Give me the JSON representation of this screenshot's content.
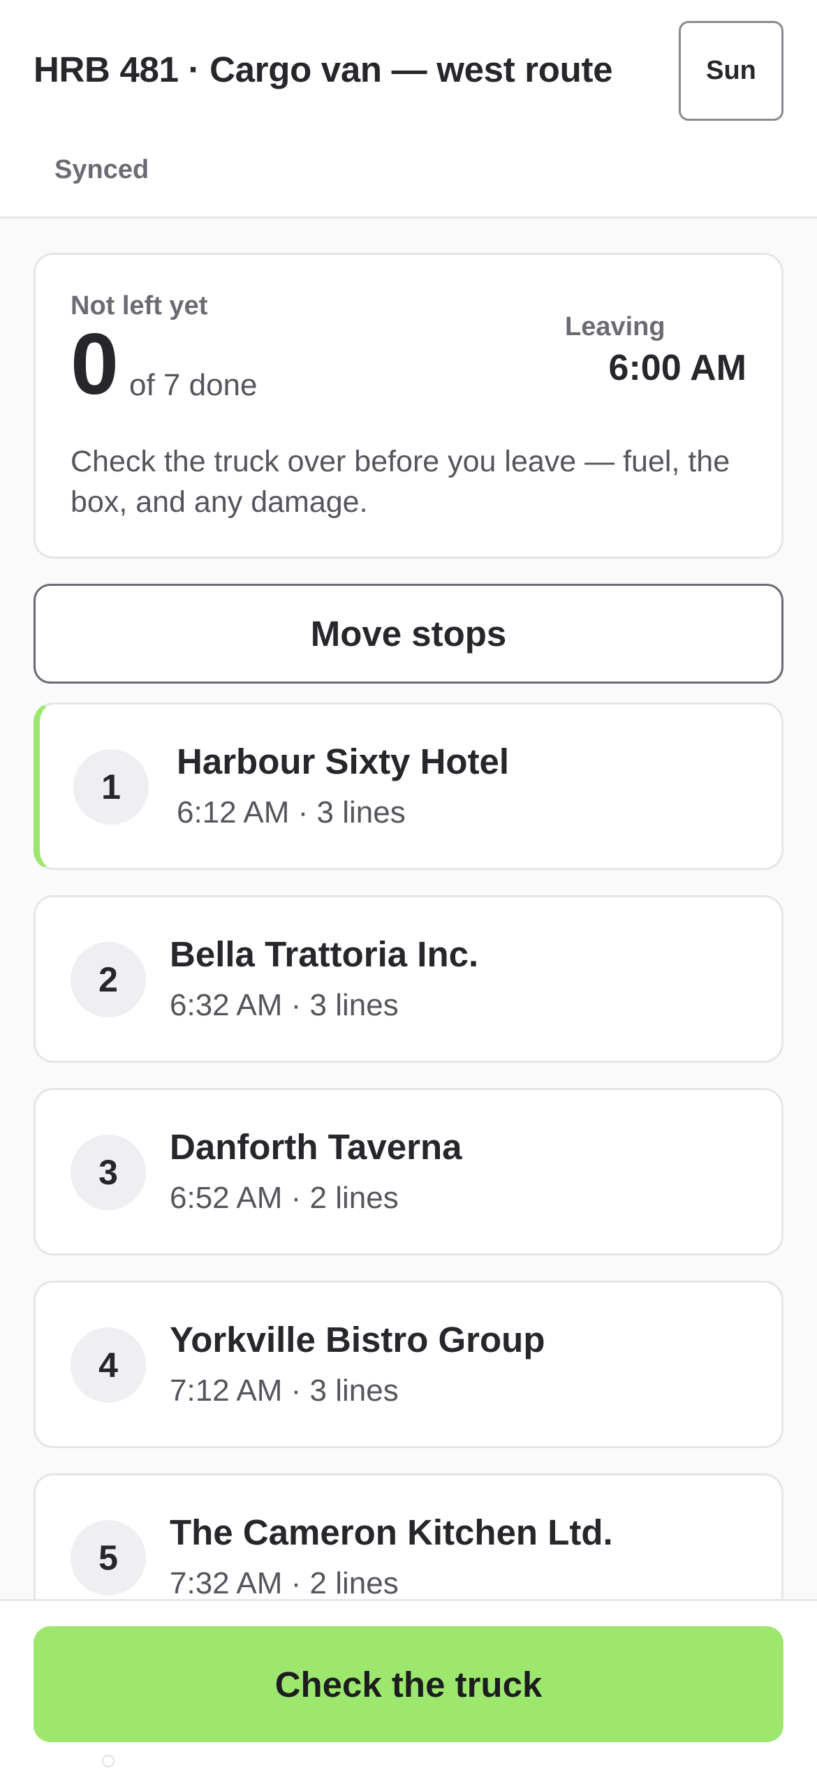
{
  "header": {
    "title": "HRB 481 · Cargo van — west route",
    "day_label": "Sun",
    "sync_status": "Synced"
  },
  "summary": {
    "status": "Not left yet",
    "done_count": "0",
    "done_total": "of 7 done",
    "leaving_label": "Leaving",
    "leaving_time": "6:00 AM",
    "message": "Check the truck over before you leave — fuel, the box, and any damage."
  },
  "actions": {
    "move_stops": "Move stops",
    "check_truck": "Check the truck"
  },
  "stops": [
    {
      "number": "1",
      "name": "Harbour Sixty Hotel",
      "meta": "6:12 AM · 3 lines",
      "current": true
    },
    {
      "number": "2",
      "name": "Bella Trattoria Inc.",
      "meta": "6:32 AM · 3 lines",
      "current": false
    },
    {
      "number": "3",
      "name": "Danforth Taverna",
      "meta": "6:52 AM · 2 lines",
      "current": false
    },
    {
      "number": "4",
      "name": "Yorkville Bistro Group",
      "meta": "7:12 AM · 3 lines",
      "current": false
    },
    {
      "number": "5",
      "name": "The Cameron Kitchen Ltd.",
      "meta": "7:32 AM · 2 lines",
      "current": false
    }
  ],
  "colors": {
    "accent": "#9ee76f",
    "current_stop_border": "#9be76e",
    "text_primary": "#26262b",
    "text_secondary": "#55555d"
  }
}
